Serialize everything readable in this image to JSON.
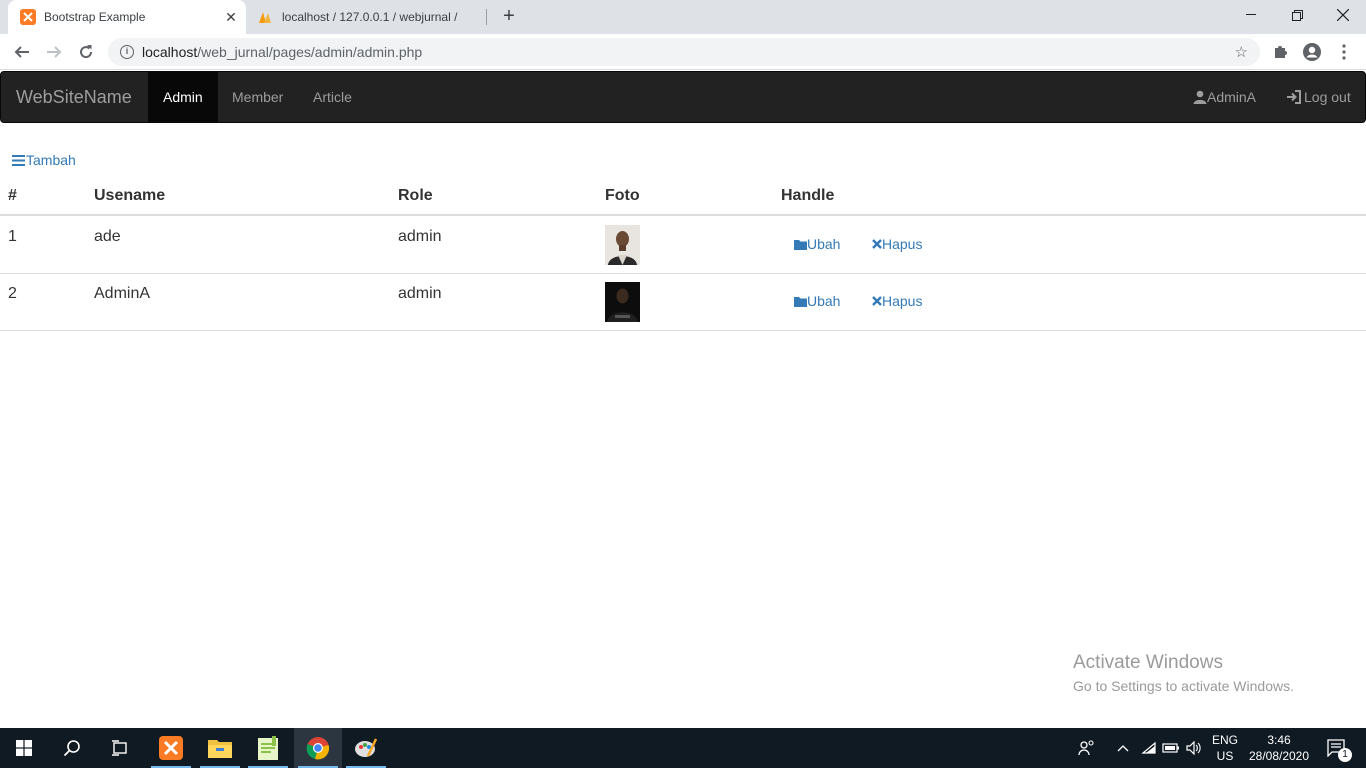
{
  "browser": {
    "tabs": [
      {
        "title": "Bootstrap Example",
        "active": true
      },
      {
        "title": "localhost / 127.0.0.1 / webjurnal /",
        "active": false
      }
    ],
    "url_host": "localhost",
    "url_path": "/web_jurnal/pages/admin/admin.php"
  },
  "navbar": {
    "brand": "WebSiteName",
    "items": [
      {
        "label": "Admin",
        "active": true
      },
      {
        "label": "Member",
        "active": false
      },
      {
        "label": "Article",
        "active": false
      }
    ],
    "user": "AdminA",
    "logout": "Log out"
  },
  "content": {
    "add_label": "Tambah",
    "columns": [
      "#",
      "Usename",
      "Role",
      "Foto",
      "Handle"
    ],
    "rows": [
      {
        "no": "1",
        "username": "ade",
        "role": "admin",
        "edit": "Ubah",
        "delete": "Hapus"
      },
      {
        "no": "2",
        "username": "AdminA",
        "role": "admin",
        "edit": "Ubah",
        "delete": "Hapus"
      }
    ]
  },
  "watermark": {
    "title": "Activate Windows",
    "subtitle": "Go to Settings to activate Windows."
  },
  "taskbar": {
    "lang": "ENG",
    "region": "US",
    "time": "3:46",
    "date": "28/08/2020",
    "notifications": "1"
  },
  "colors": {
    "navbar_bg": "#222222",
    "link": "#337ab7",
    "taskbar_bg": "#101a23"
  }
}
